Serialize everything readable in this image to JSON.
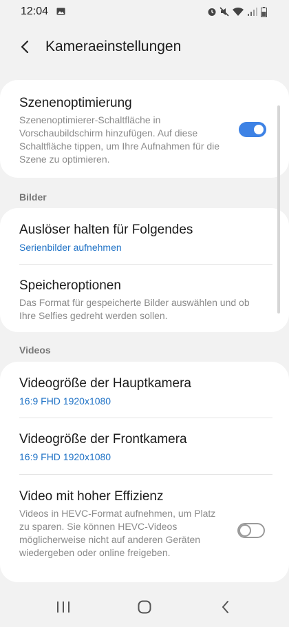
{
  "status_bar": {
    "time": "12:04",
    "left_icons": [
      "image-icon"
    ],
    "right_icons": [
      "alarm-icon",
      "mute-icon",
      "wifi-icon",
      "signal-icon",
      "battery-icon"
    ]
  },
  "header": {
    "back_icon": "back-arrow-icon",
    "title": "Kameraeinstellungen"
  },
  "scene_card": {
    "title": "Szenenoptimierung",
    "description": "Szenenoptimierer-Schaltfläche in Vorschaubildschirm hinzufügen. Auf diese Schaltfläche tippen, um Ihre Aufnahmen für die Szene zu optimieren.",
    "toggle_on": true
  },
  "bilder": {
    "header": "Bilder",
    "items": [
      {
        "title": "Auslöser halten für Folgendes",
        "value": "Serienbilder aufnehmen"
      },
      {
        "title": "Speicheroptionen",
        "description": "Das Format für gespeicherte Bilder auswählen und ob Ihre Selfies gedreht werden sollen."
      }
    ]
  },
  "videos": {
    "header": "Videos",
    "items": [
      {
        "title": "Videogröße der Hauptkamera",
        "value": "16:9 FHD 1920x1080"
      },
      {
        "title": "Videogröße der Frontkamera",
        "value": "16:9 FHD 1920x1080"
      },
      {
        "title": "Video mit hoher Effizienz",
        "description": "Videos in HEVC-Format aufnehmen, um Platz zu sparen. Sie können HEVC-Videos möglicherweise nicht auf anderen Geräten wiedergeben oder online freigeben.",
        "toggle_on": false
      }
    ]
  },
  "nav_bar": {
    "icons": [
      "recent-apps-icon",
      "home-icon",
      "back-icon"
    ]
  },
  "colors": {
    "accent": "#3d82e5",
    "link": "#1f72c6",
    "background": "#f2f2f2",
    "card": "#ffffff"
  }
}
